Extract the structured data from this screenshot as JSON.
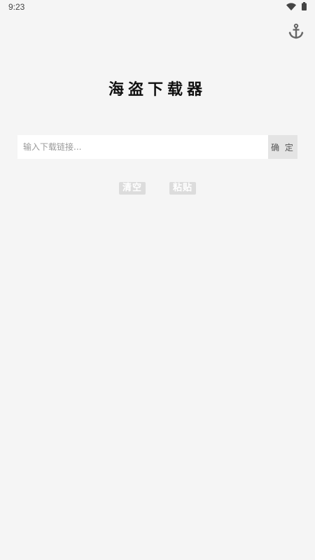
{
  "status_bar": {
    "time": "9:23",
    "icons": [
      "wifi-icon",
      "battery-icon"
    ]
  },
  "header": {
    "anchor_icon": "anchor-icon",
    "title": "海盗下载器"
  },
  "search": {
    "placeholder": "输入下载链接...",
    "value": "",
    "confirm_label": "确 定"
  },
  "actions": {
    "clear_label": "清空",
    "paste_label": "粘贴"
  },
  "colors": {
    "background": "#f5f5f5",
    "input_bg": "#ffffff",
    "confirm_bg": "#e4e4e4",
    "action_bg": "#dcdcdc",
    "icon": "#666666"
  }
}
